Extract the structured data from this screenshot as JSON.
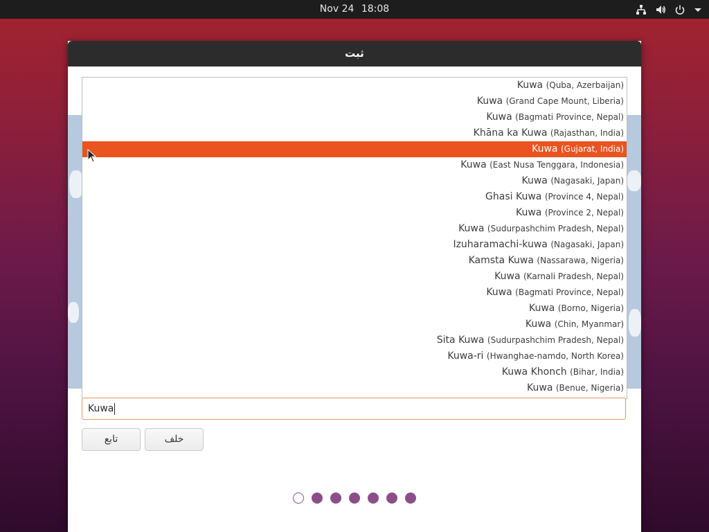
{
  "topbar": {
    "date": "Nov 24",
    "time": "18:08",
    "icons": [
      "network-wired-icon",
      "volume-icon",
      "power-icon",
      "menu-arrow-down-icon"
    ]
  },
  "window": {
    "title": "ثبت"
  },
  "timezone_list": {
    "selected_index": 4,
    "items": [
      {
        "name": "Kuwa",
        "region": "(Quba, Azerbaijan)"
      },
      {
        "name": "Kuwa",
        "region": "(Grand Cape Mount, Liberia)"
      },
      {
        "name": "Kuwa",
        "region": "(Bagmati Province, Nepal)"
      },
      {
        "name": "Khāna ka Kuwa",
        "region": "(Rajasthan, India)"
      },
      {
        "name": "Kuwa",
        "region": "(Gujarat, India)"
      },
      {
        "name": "Kuwa",
        "region": "(East Nusa Tenggara, Indonesia)"
      },
      {
        "name": "Kuwa",
        "region": "(Nagasaki, Japan)"
      },
      {
        "name": "Ghasi Kuwa",
        "region": "(Province 4, Nepal)"
      },
      {
        "name": "Kuwa",
        "region": "(Province 2, Nepal)"
      },
      {
        "name": "Kuwa",
        "region": "(Sudurpashchim Pradesh, Nepal)"
      },
      {
        "name": "Izuharamachi-kuwa",
        "region": "(Nagasaki, Japan)"
      },
      {
        "name": "Kamsta Kuwa",
        "region": "(Nassarawa, Nigeria)"
      },
      {
        "name": "Kuwa",
        "region": "(Karnali Pradesh, Nepal)"
      },
      {
        "name": "Kuwa",
        "region": "(Bagmati Province, Nepal)"
      },
      {
        "name": "Kuwa",
        "region": "(Borno, Nigeria)"
      },
      {
        "name": "Kuwa",
        "region": "(Chin, Myanmar)"
      },
      {
        "name": "Sita Kuwa",
        "region": "(Sudurpashchim Pradesh, Nepal)"
      },
      {
        "name": "Kuwa-ri",
        "region": "(Hwanghae-namdo, North Korea)"
      },
      {
        "name": "Kuwa Khonch",
        "region": "(Bihar, India)"
      },
      {
        "name": "Kuwa",
        "region": "(Benue, Nigeria)"
      }
    ]
  },
  "search": {
    "value": "Kuwa"
  },
  "buttons": {
    "continue_label": "تابع",
    "back_label": "خلف"
  },
  "progress": {
    "total_steps": 7,
    "current_step": 1
  },
  "colors": {
    "accent": "#e95420",
    "dot": "#8b4e8a",
    "topbar": "#1d1d1d",
    "titlebar": "#2c2c2c"
  }
}
